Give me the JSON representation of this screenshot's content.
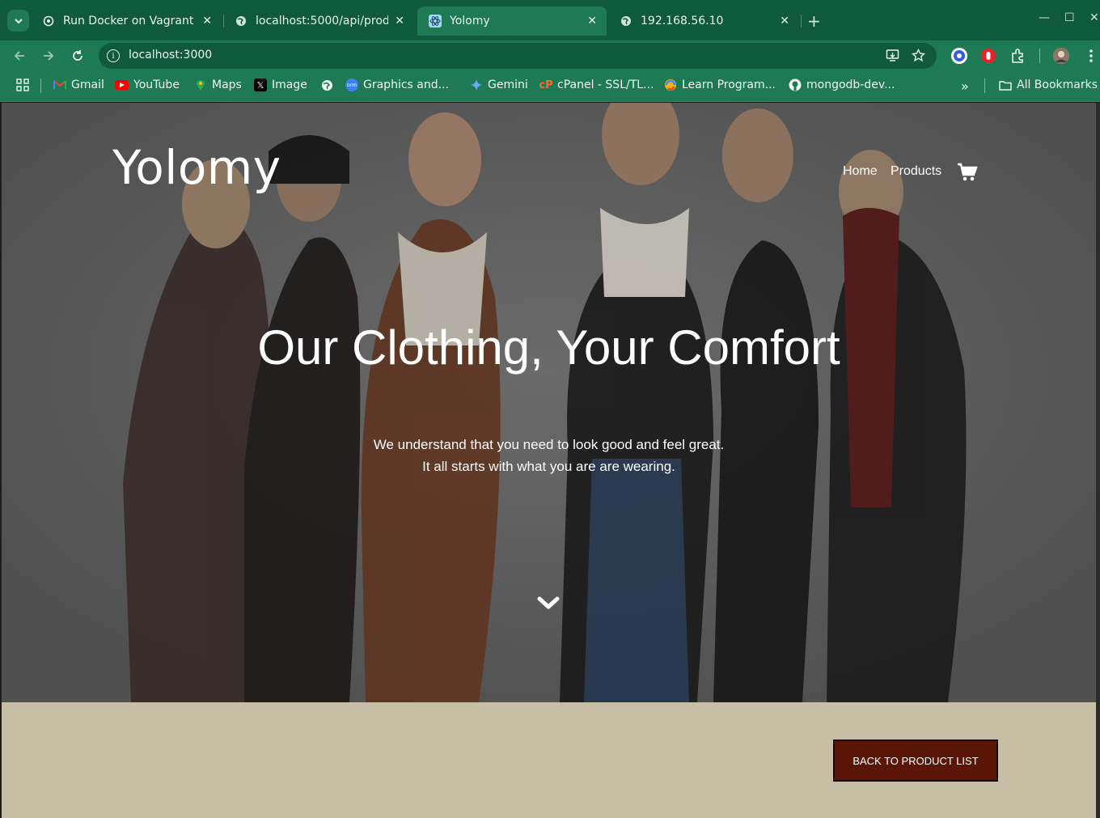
{
  "browser": {
    "tabs": [
      {
        "title": "Run Docker on Vagrant",
        "icon": "openai-icon"
      },
      {
        "title": "localhost:5000/api/prod",
        "icon": "globe-icon"
      },
      {
        "title": "Yolomy",
        "icon": "react-icon"
      },
      {
        "title": "192.168.56.10",
        "icon": "globe-icon"
      }
    ],
    "url": "localhost:3000",
    "bookmarks": [
      {
        "label": "Gmail"
      },
      {
        "label": "YouTube"
      },
      {
        "label": "Maps"
      },
      {
        "label": "Image"
      },
      {
        "label": "Graphics and..."
      },
      {
        "label": "Gemini"
      },
      {
        "label": "cPanel - SSL/TL..."
      },
      {
        "label": "Learn Program..."
      },
      {
        "label": "mongodb-dev..."
      }
    ],
    "more_bookmarks": "»",
    "all_bookmarks": "All Bookmarks",
    "theme_color": "#1e7a55"
  },
  "page": {
    "brand": "Yolomy",
    "nav": {
      "home": "Home",
      "products": "Products"
    },
    "headline": "Our Clothing, Your Comfort",
    "subline1": "We understand that you need to look good and feel great.",
    "subline2": "It all starts with what you are are wearing.",
    "back_button": "BACK TO PRODUCT LIST",
    "accent_color": "#5a1707",
    "section_bg": "#c7bea6"
  }
}
